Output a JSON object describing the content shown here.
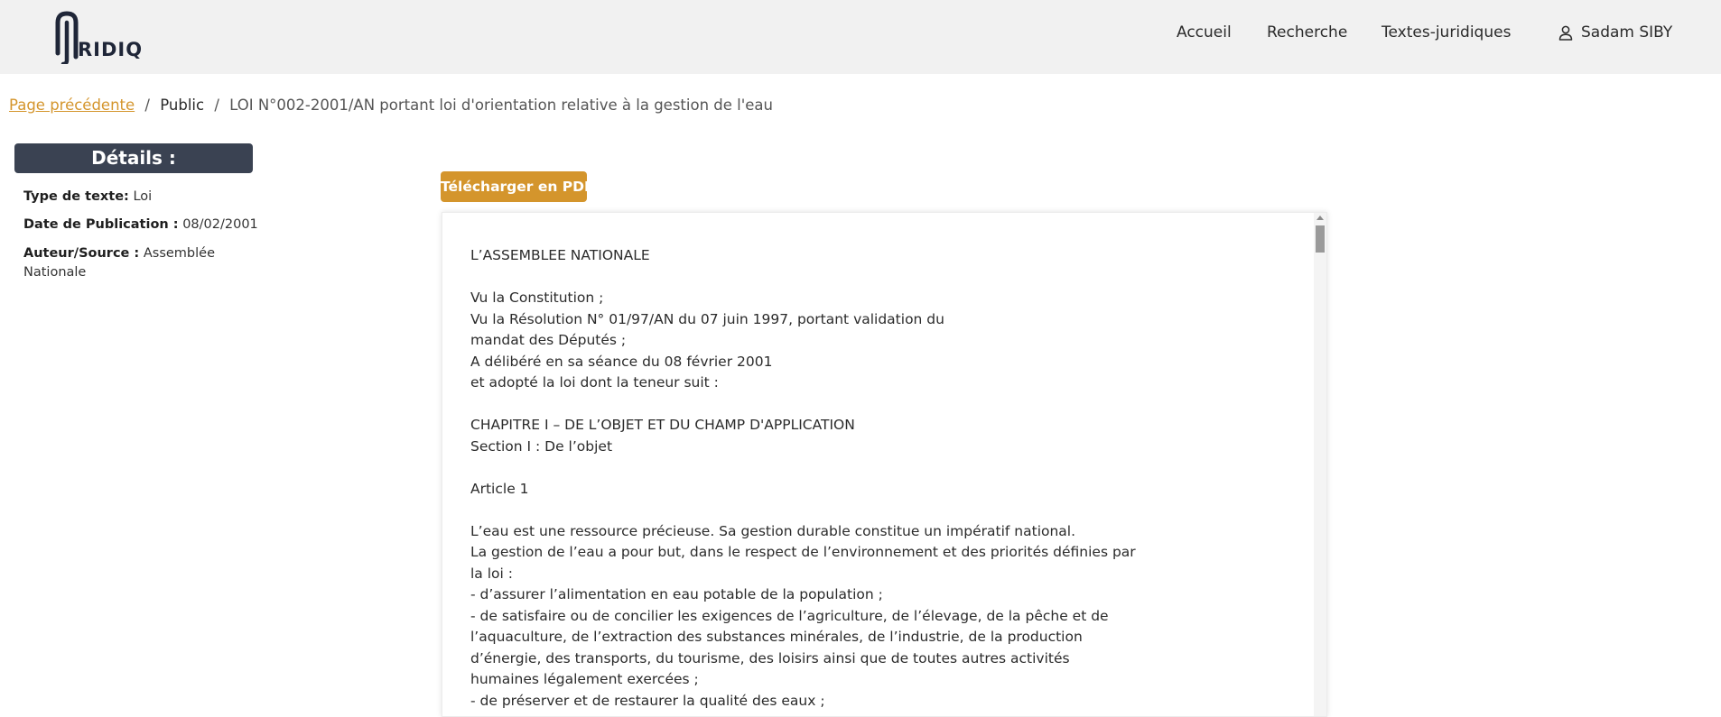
{
  "brand": {
    "logo_text": "RIDIQ"
  },
  "nav": {
    "home": "Accueil",
    "search": "Recherche",
    "texts": "Textes-juridiques",
    "user": "Sadam SIBY"
  },
  "breadcrumb": {
    "back": "Page précédente",
    "sep": "/",
    "public": "Public",
    "current": "LOI N°002-2001/AN portant loi d'orientation relative à la gestion de l'eau"
  },
  "details": {
    "title": "Détails :",
    "type_label": "Type de texte:",
    "type_value": "Loi",
    "date_label": "Date de Publication :",
    "date_value": "08/02/2001",
    "author_label": "Auteur/Source :",
    "author_value_line1": "Assemblée",
    "author_value_line2": "Nationale"
  },
  "actions": {
    "download_pdf": "Télécharger en PDF"
  },
  "document": {
    "lines": [
      "L’ASSEMBLEE NATIONALE",
      "",
      "Vu la Constitution ;",
      "Vu la Résolution N° 01/97/AN du 07 juin 1997, portant validation du",
      "mandat des Députés ;",
      "A délibéré en sa séance du 08 février 2001",
      "et adopté la loi dont la teneur suit :",
      "",
      "CHAPITRE I – DE L’OBJET ET DU CHAMP D'APPLICATION",
      "Section I : De l’objet",
      "",
      "Article 1",
      "",
      "L’eau est une ressource précieuse. Sa gestion durable constitue un impératif national.",
      "La gestion de l’eau a pour but, dans le respect de l’environnement et des priorités définies par",
      "la loi :",
      "- d’assurer l’alimentation en eau potable de la population ;",
      "- de satisfaire ou de concilier les exigences de l’agriculture, de l’élevage, de la pêche et de",
      "l’aquaculture, de l’extraction des substances minérales, de l’industrie, de la production",
      "d’énergie, des transports, du tourisme, des loisirs ainsi que de toutes autres activités",
      "humaines légalement exercées ;",
      "- de préserver et de restaurer la qualité des eaux ;"
    ]
  },
  "colors": {
    "accent": "#d4952c",
    "dark": "#3a4252",
    "header_bg": "#f1f1f1"
  }
}
